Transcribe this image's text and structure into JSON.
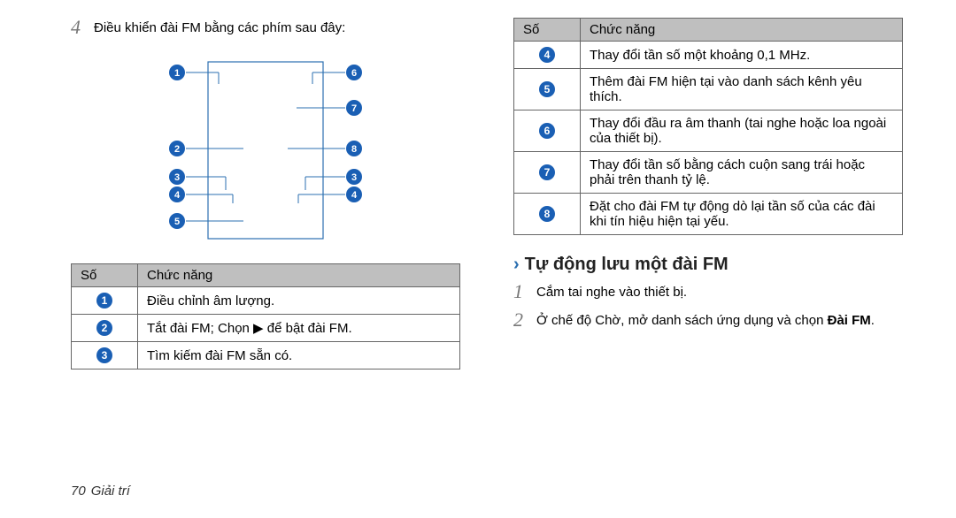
{
  "left": {
    "step4_num": "4",
    "step4_text": "Điều khiển đài FM bằng các phím sau đây:",
    "table_headers": [
      "Số",
      "Chức năng"
    ],
    "rows": [
      {
        "n": "1",
        "desc": "Điều chỉnh âm lượng."
      },
      {
        "n": "2",
        "desc": "Tắt đài FM; Chọn ▶ để bật đài FM."
      },
      {
        "n": "3",
        "desc": "Tìm kiếm đài FM sẵn có."
      }
    ]
  },
  "right": {
    "table_headers": [
      "Số",
      "Chức năng"
    ],
    "rows": [
      {
        "n": "4",
        "desc": "Thay đổi tần số một khoảng 0,1 MHz."
      },
      {
        "n": "5",
        "desc": "Thêm đài FM hiện tại vào danh sách kênh yêu thích."
      },
      {
        "n": "6",
        "desc": "Thay đổi đầu ra âm thanh (tai nghe hoặc loa ngoài của thiết bị)."
      },
      {
        "n": "7",
        "desc": "Thay đổi tần số bằng cách cuộn sang trái hoặc phải trên thanh tỷ lệ."
      },
      {
        "n": "8",
        "desc": "Đặt cho đài FM tự động dò lại tần số của các đài khi tín hiệu hiện tại yếu."
      }
    ],
    "heading": "Tự động lưu một đài FM",
    "step1_num": "1",
    "step1_text": "Cắm tai nghe vào thiết bị.",
    "step2_num": "2",
    "step2_text_pre": "Ở chế độ Chờ, mở danh sách ứng dụng và chọn ",
    "step2_bold": "Đài FM",
    "step2_text_post": "."
  },
  "diagram": {
    "left_labels": [
      "1",
      "2",
      "3",
      "4",
      "5"
    ],
    "right_labels": [
      "6",
      "7",
      "8",
      "3",
      "4"
    ]
  },
  "footer": {
    "page": "70",
    "section": "Giải trí"
  }
}
